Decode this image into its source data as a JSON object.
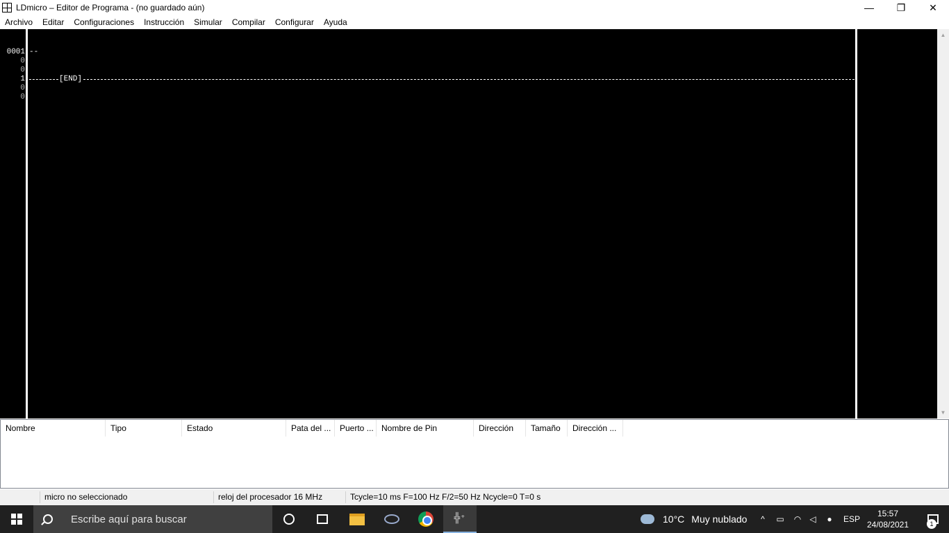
{
  "window": {
    "title": "LDmicro – Editor de Programa - (no guardado aún)",
    "minimize": "—",
    "maximize": "❐",
    "close": "✕"
  },
  "menu": [
    "Archivo",
    "Editar",
    "Configuraciones",
    "Instrucción",
    "Simular",
    "Compilar",
    "Configurar",
    "Ayuda"
  ],
  "ladder": {
    "rung1_number": "0001",
    "rung1_sub1": "0",
    "rung1_sub2": "0",
    "rung1_wire": "--",
    "end_number": "1",
    "end_sub1": "0",
    "end_sub2": "0",
    "end_label": "[END]"
  },
  "io_columns": [
    "Nombre",
    "Tipo",
    "Estado",
    "Pata del ...",
    "Puerto ...",
    "Nombre de Pin",
    "Dirección",
    "Tamaño",
    "Dirección ..."
  ],
  "status": {
    "micro": "micro no seleccionado",
    "clock": "reloj del procesador 16 MHz",
    "cycle": "Tcycle=10 ms F=100 Hz F/2=50 Hz Ncycle=0 T=0 s"
  },
  "taskbar": {
    "search_placeholder": "Escribe aquí para buscar",
    "weather_temp": "10°C",
    "weather_desc": "Muy nublado",
    "language": "ESP",
    "time": "15:57",
    "date": "24/08/2021",
    "notification_count": "1",
    "ldmicro_glyph": "╬⁺"
  }
}
